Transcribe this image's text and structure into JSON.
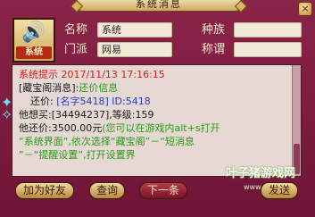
{
  "window": {
    "title": "系统消息",
    "close_glyph": "×"
  },
  "avatar": {
    "label": "系统",
    "icon": "speaker-icon",
    "glyph": "🔊"
  },
  "fields": {
    "name_label": "名称",
    "name_value": "系统",
    "race_label": "种族",
    "race_value": "",
    "faction_label": "门派",
    "faction_value": "网易",
    "title_label": "称谓",
    "title_value": ""
  },
  "message": {
    "line1": "系统提示 2017/11/13 17:16:15",
    "line2a": "[藏宝阁消息]:",
    "line2b": "还价信息",
    "line3a": "还价:",
    "line3b": "[名字5418]",
    "line3c": "ID:5418",
    "line4": "他想买:[34494237],等级:159",
    "line5a": "他还价:3500.00元",
    "line5b": "(您可以在游戏内alt+s打开",
    "line6": "“系统界面”,依次选择“藏宝阁”－“短消息",
    "line7": "”－“提醒设置”,打开设置界"
  },
  "watermark": {
    "text": "叶子猪游戏网",
    "url": "www.yzz.cn"
  },
  "buttons": {
    "add_friend": "加为好友",
    "query": "查询",
    "next": "下一条",
    "send": "发送"
  },
  "colors": {
    "frame": "#7a1d40",
    "panel": "#e6d9d4",
    "alert": "#e01818"
  }
}
